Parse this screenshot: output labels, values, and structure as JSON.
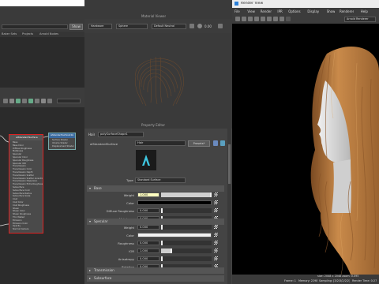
{
  "left_panel": {
    "tabs": [
      "Baker Sets",
      "Projects",
      "Arnold Nodes"
    ],
    "show_label": "Show",
    "main_node": {
      "title": "aiStandardSurface",
      "ports": [
        "Base",
        "Base Color",
        "Diffuse Roughness",
        "Metalness",
        "Specular",
        "Specular Color",
        "Specular Roughness",
        "Specular IOR",
        "Transmission",
        "Transmission Color",
        "Transmission Depth",
        "Transmission Scatter",
        "Transmission Scatter Anisotropy",
        "Transmission Dispersion",
        "Transmission Extra Roughness",
        "Subsurface",
        "Subsurface Color",
        "Subsurface Radius",
        "Subsurface Scale",
        "Coat",
        "Coat Color",
        "Coat Roughness",
        "Sheen",
        "Sheen Color",
        "Sheen Roughness",
        "Thin Walled",
        "Emission",
        "Emission Color",
        "Opacity",
        "Normal Camera"
      ]
    },
    "shading_group_node": {
      "title": "aiStandardSurface1SG",
      "ports": [
        "Surface Shader",
        "Volume Shader",
        "Displacement Shader"
      ]
    }
  },
  "center_panel": {
    "material_viewer_title": "Material Viewer",
    "renderer": "Hardware",
    "shape": "Sphere",
    "environment": "Default Neutral",
    "exposure": "0.00",
    "property_editor_title": "Property Editor",
    "tabs": [
      "Hair",
      "polySurfaceShape1"
    ],
    "shader_type_label": "aiStandardSurface",
    "shader_name": "Hair",
    "presets_label": "Presets*",
    "type_dropdown": "Standard Surface",
    "type_label": "Type",
    "sections": {
      "base": "Base",
      "specular": "Specular",
      "transmission": "Transmission",
      "subsurface": "Subsurface"
    },
    "base_attrs": [
      {
        "label": "Weight",
        "value": "1.000",
        "fill": 1.0
      },
      {
        "label": "Color",
        "value": "",
        "fill": 0
      },
      {
        "label": "Diffuse Roughness",
        "value": "0.000",
        "fill": 0.0
      },
      {
        "label": "Metalness",
        "value": "0.000",
        "fill": 0.0
      }
    ],
    "specular_attrs": [
      {
        "label": "Weight",
        "value": "0.000",
        "fill": 0.0
      },
      {
        "label": "Color",
        "value": "",
        "fill": 0
      },
      {
        "label": "Roughness",
        "value": "0.000",
        "fill": 0.0
      },
      {
        "label": "IOR",
        "value": "1.000",
        "fill": 0.2
      },
      {
        "label": "Anisotropy",
        "value": "0.000",
        "fill": 0.0
      },
      {
        "label": "Rotation",
        "value": "0.000",
        "fill": 0.0
      }
    ]
  },
  "render_view": {
    "title": "Render View",
    "menus": [
      "File",
      "View",
      "Render",
      "IPR",
      "Options",
      "Display",
      "Show",
      "Renderer",
      "Help"
    ],
    "renderer": "Arnold Renderer",
    "status_size": "size: 2048 x 2048 zoom: 0.095",
    "status_frame": "Frame: 1",
    "status_memory": "Memory: 2298",
    "status_sampling": "Sampling: [3/2/3/2/2/2]",
    "status_render_time": "Render Time: 0:27"
  },
  "colors": {
    "hair_light": "#c98a4a",
    "hair_dark": "#7a4a22",
    "node_selection": "#dd2222",
    "accent_blue": "#3a6aa0"
  }
}
